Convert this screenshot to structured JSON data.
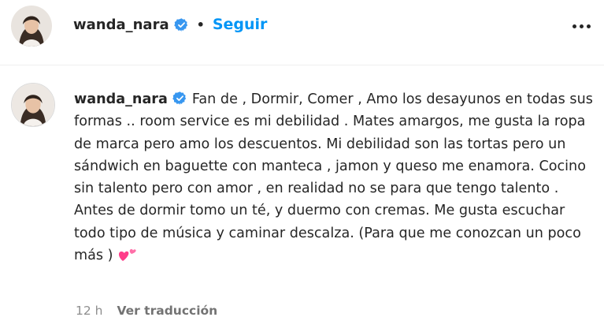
{
  "header": {
    "username": "wanda_nara",
    "separator": "•",
    "follow_label": "Seguir",
    "avatar_icon": "profile-photo-icon",
    "verified_icon": "verified-badge-icon",
    "more_icon": "more-options-icon"
  },
  "post": {
    "username": "wanda_nara",
    "caption": "Fan de , Dormir, Comer , Amo los desayunos en todas sus formas .. room service es mi debilidad . Mates amargos, me gusta la ropa de marca pero amo los descuentos. Mi debilidad son las tortas pero un sándwich en baguette con manteca , jamon y queso me enamora. Cocino sin talento pero con amor , en realidad no se para que tengo talento . Antes de dormir tomo un té, y duermo con cremas. Me gusta escuchar todo tipo de música y caminar descalza. (Para que me conozcan un poco más )",
    "emoji_icon": "two-hearts-icon",
    "time": "12 h",
    "translate_label": "Ver traducción"
  },
  "colors": {
    "link_blue": "#0095f6",
    "verified_blue": "#3897f0",
    "text": "#262626",
    "muted": "#8e8e8e",
    "heart_pink": "#ff3e8a"
  }
}
